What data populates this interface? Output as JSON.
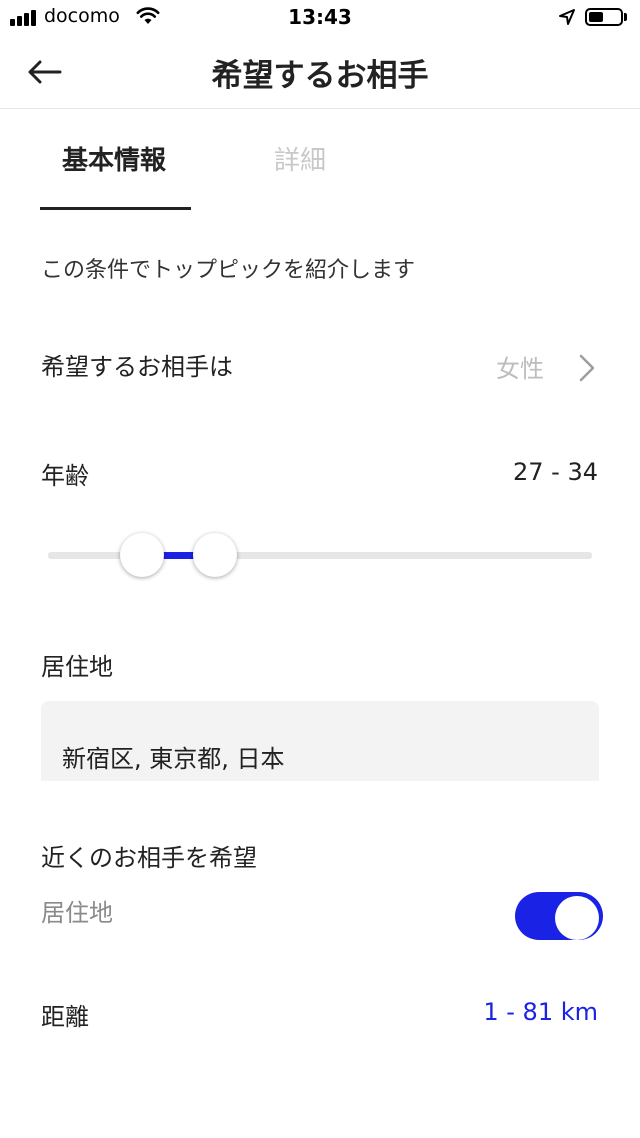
{
  "status_bar": {
    "carrier": "docomo",
    "time": "13:43",
    "icons": [
      "signal-icon",
      "wifi-icon",
      "location-arrow-icon",
      "battery-icon"
    ]
  },
  "header": {
    "title": "希望するお相手",
    "back_icon": "back-arrow-icon"
  },
  "tabs": [
    {
      "label": "基本情報",
      "active": true
    },
    {
      "label": "詳細",
      "active": false
    }
  ],
  "intro_text": "この条件でトップピックを紹介します",
  "gender": {
    "label": "希望するお相手は",
    "value": "女性",
    "icon": "chevron-right-icon"
  },
  "age": {
    "label": "年齢",
    "value": "27 - 34"
  },
  "residence": {
    "label": "居住地",
    "value": "新宿区, 東京都, 日本"
  },
  "nearby": {
    "label": "近くのお相手を希望",
    "sublabel": "居住地",
    "enabled": true
  },
  "distance": {
    "label": "距離",
    "value": "1 - 81 km"
  },
  "colors": {
    "accent": "#1a22e6",
    "muted_text": "#bdbdbd",
    "input_bg": "#f3f3f3"
  }
}
